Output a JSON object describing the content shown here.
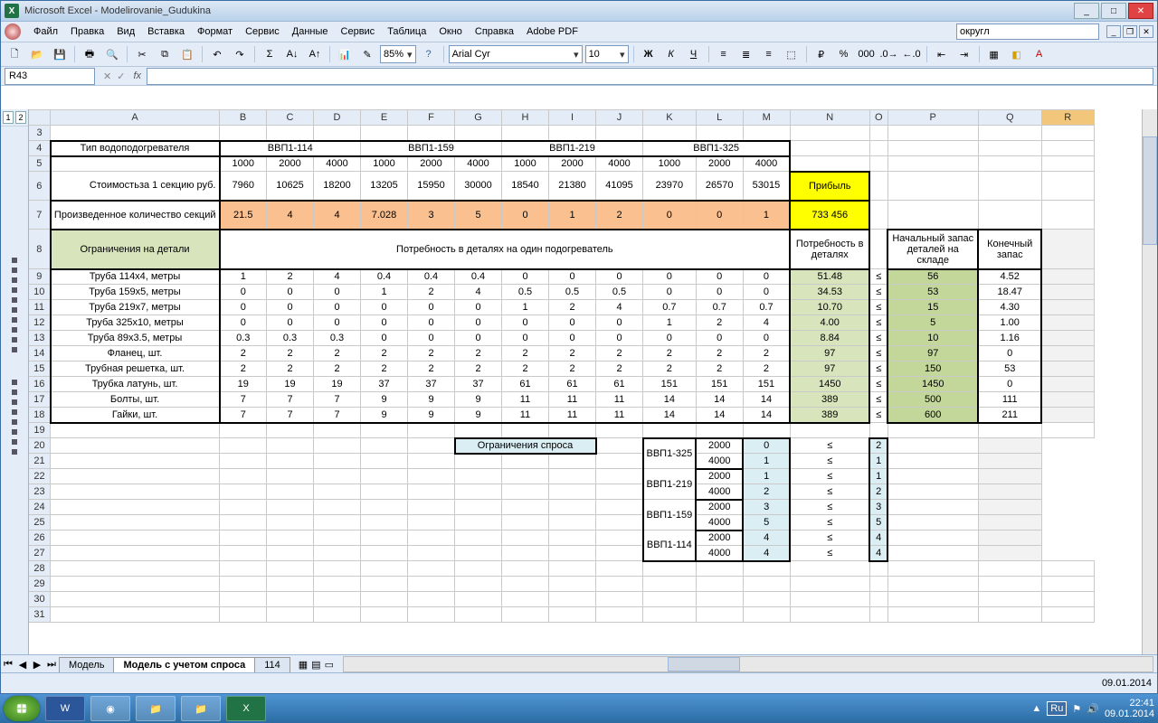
{
  "title": "Microsoft Excel - Modelirovanie_Gudukina",
  "menu": [
    "Файл",
    "Правка",
    "Вид",
    "Вставка",
    "Формат",
    "Сервис",
    "Данные",
    "Сервис",
    "Таблица",
    "Окно",
    "Справка",
    "Adobe PDF"
  ],
  "helpbox": "округл",
  "zoom": "85%",
  "font": "Arial Cyr",
  "fontsize": "10",
  "namebox": "R43",
  "cols": [
    "",
    "A",
    "B",
    "C",
    "D",
    "E",
    "F",
    "G",
    "H",
    "I",
    "J",
    "K",
    "L",
    "M",
    "N",
    "O",
    "P",
    "Q",
    "R"
  ],
  "h_type": "Тип водоподогревателя",
  "types": [
    "ВВП1-114",
    "ВВП1-159",
    "ВВП1-219",
    "ВВП1-325"
  ],
  "lens": [
    "1000",
    "2000",
    "4000"
  ],
  "h_cost": "Стоимостьза 1 секцию руб.",
  "cost": [
    "7960",
    "10625",
    "18200",
    "13205",
    "15950",
    "30000",
    "18540",
    "21380",
    "41095",
    "23970",
    "26570",
    "53015"
  ],
  "h_profit": "Прибыль",
  "h_prod": "Произведенное количество секций",
  "prod": [
    "21.5",
    "4",
    "4",
    "7.028",
    "3",
    "5",
    "0",
    "1",
    "2",
    "0",
    "0",
    "1"
  ],
  "profit": "733 456",
  "h_constr": "Ограничения на детали",
  "h_need": "Потребность в деталях на один подогреватель",
  "h_totneed": "Потребность в деталях",
  "h_stock": "Начальный запас деталей на складе",
  "h_rem": "Конечный запас",
  "le": "≤",
  "parts": [
    {
      "n": "Труба 114х4, метры",
      "v": [
        "1",
        "2",
        "4",
        "0.4",
        "0.4",
        "0.4",
        "0",
        "0",
        "0",
        "0",
        "0",
        "0"
      ],
      "t": "51.48",
      "s": "56",
      "r": "4.52"
    },
    {
      "n": "Труба 159х5, метры",
      "v": [
        "0",
        "0",
        "0",
        "1",
        "2",
        "4",
        "0.5",
        "0.5",
        "0.5",
        "0",
        "0",
        "0"
      ],
      "t": "34.53",
      "s": "53",
      "r": "18.47"
    },
    {
      "n": "Труба 219х7, метры",
      "v": [
        "0",
        "0",
        "0",
        "0",
        "0",
        "0",
        "1",
        "2",
        "4",
        "0.7",
        "0.7",
        "0.7"
      ],
      "t": "10.70",
      "s": "15",
      "r": "4.30"
    },
    {
      "n": "Труба 325х10, метры",
      "v": [
        "0",
        "0",
        "0",
        "0",
        "0",
        "0",
        "0",
        "0",
        "0",
        "1",
        "2",
        "4"
      ],
      "t": "4.00",
      "s": "5",
      "r": "1.00"
    },
    {
      "n": "Труба 89х3.5, метры",
      "v": [
        "0.3",
        "0.3",
        "0.3",
        "0",
        "0",
        "0",
        "0",
        "0",
        "0",
        "0",
        "0",
        "0"
      ],
      "t": "8.84",
      "s": "10",
      "r": "1.16"
    },
    {
      "n": "Фланец, шт.",
      "v": [
        "2",
        "2",
        "2",
        "2",
        "2",
        "2",
        "2",
        "2",
        "2",
        "2",
        "2",
        "2"
      ],
      "t": "97",
      "s": "97",
      "r": "0"
    },
    {
      "n": "Трубная решетка, шт.",
      "v": [
        "2",
        "2",
        "2",
        "2",
        "2",
        "2",
        "2",
        "2",
        "2",
        "2",
        "2",
        "2"
      ],
      "t": "97",
      "s": "150",
      "r": "53"
    },
    {
      "n": "Трубка латунь, шт.",
      "v": [
        "19",
        "19",
        "19",
        "37",
        "37",
        "37",
        "61",
        "61",
        "61",
        "151",
        "151",
        "151"
      ],
      "t": "1450",
      "s": "1450",
      "r": "0"
    },
    {
      "n": "Болты, шт.",
      "v": [
        "7",
        "7",
        "7",
        "9",
        "9",
        "9",
        "11",
        "11",
        "11",
        "14",
        "14",
        "14"
      ],
      "t": "389",
      "s": "500",
      "r": "111"
    },
    {
      "n": "Гайки, шт.",
      "v": [
        "7",
        "7",
        "7",
        "9",
        "9",
        "9",
        "11",
        "11",
        "11",
        "14",
        "14",
        "14"
      ],
      "t": "389",
      "s": "600",
      "r": "211"
    }
  ],
  "h_demand": "Ограничения спроса",
  "demand": [
    {
      "n": "ВВП1-325",
      "a": "2000",
      "p": "0",
      "l": "2"
    },
    {
      "n": "",
      "a": "4000",
      "p": "1",
      "l": "1"
    },
    {
      "n": "ВВП1-219",
      "a": "2000",
      "p": "1",
      "l": "1"
    },
    {
      "n": "",
      "a": "4000",
      "p": "2",
      "l": "2"
    },
    {
      "n": "ВВП1-159",
      "a": "2000",
      "p": "3",
      "l": "3"
    },
    {
      "n": "",
      "a": "4000",
      "p": "5",
      "l": "5"
    },
    {
      "n": "ВВП1-114",
      "a": "2000",
      "p": "4",
      "l": "4"
    },
    {
      "n": "",
      "a": "4000",
      "p": "4",
      "l": "4"
    }
  ],
  "tabs": [
    "Модель",
    "Модель с учетом спроса",
    "114"
  ],
  "activeTab": 1,
  "statusdate": "09.01.2014",
  "clock_time": "22:41",
  "clock_date": "09.01.2014",
  "lang": "Ru"
}
